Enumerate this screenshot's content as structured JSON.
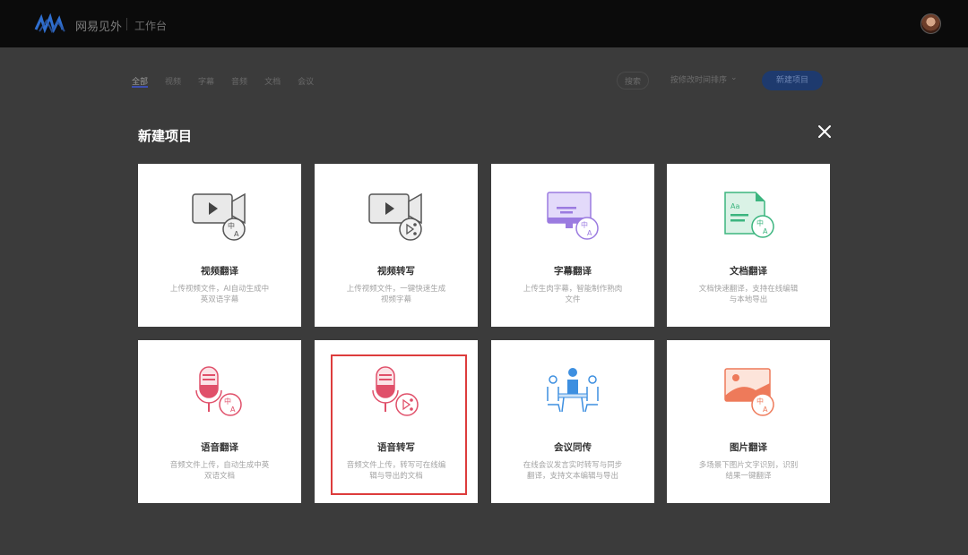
{
  "header": {
    "brand_name": "网易见外",
    "workspace_label": "工作台"
  },
  "filters": {
    "tabs": [
      "全部",
      "视频",
      "字幕",
      "音频",
      "文档",
      "会议"
    ],
    "search_label": "搜索",
    "sort_label": "按修改时间排序",
    "new_project_label": "新建项目"
  },
  "modal": {
    "title": "新建项目",
    "cards": [
      {
        "title": "视频翻译",
        "desc": "上传视频文件，AI自动生成中英双语字幕",
        "icon": "video-translate-icon"
      },
      {
        "title": "视频转写",
        "desc": "上传视频文件，一键快速生成视频字幕",
        "icon": "video-transcribe-icon"
      },
      {
        "title": "字幕翻译",
        "desc": "上传生肉字幕，智能制作熟肉文件",
        "icon": "subtitle-translate-icon"
      },
      {
        "title": "文档翻译",
        "desc": "文档快速翻译，支持在线编辑与本地导出",
        "icon": "document-translate-icon"
      },
      {
        "title": "语音翻译",
        "desc": "音频文件上传，自动生成中英双语文档",
        "icon": "audio-translate-icon"
      },
      {
        "title": "语音转写",
        "desc": "音频文件上传，转写可在线编辑与导出的文档",
        "icon": "audio-transcribe-icon"
      },
      {
        "title": "会议同传",
        "desc": "在线会议发言实时转写与同步翻译，支持文本编辑与导出",
        "icon": "meeting-interpret-icon"
      },
      {
        "title": "图片翻译",
        "desc": "多场景下图片文字识别，识别结果一键翻译",
        "icon": "image-translate-icon"
      }
    ]
  },
  "colors": {
    "topbar": "#0b0b0b",
    "overlay": "#3b3b3b",
    "highlight_border": "#dd3c3c",
    "video_icon": "#555555",
    "subtitle_icon": "#9b7be0",
    "document_icon": "#3cb57f",
    "audio_icon": "#e0506a",
    "meeting_icon": "#3d8fe0",
    "image_icon": "#ee7a5a"
  }
}
